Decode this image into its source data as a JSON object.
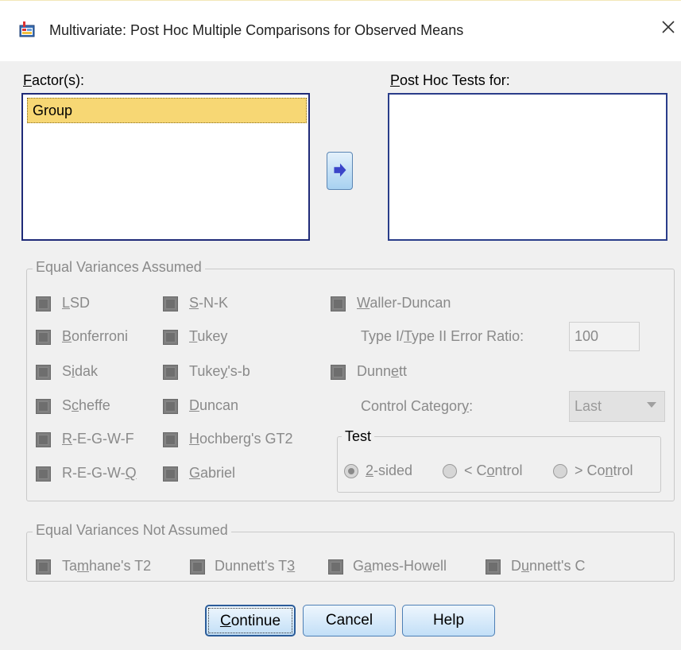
{
  "window": {
    "title": "Multivariate: Post Hoc Multiple Comparisons for Observed Means",
    "close_glyph": "✕",
    "icon": "spss-dialog-icon"
  },
  "factors": {
    "label_u": "F",
    "label_rest": "actor(s):",
    "items": [
      "Group"
    ]
  },
  "move_button": {
    "icon": "arrow-right-icon"
  },
  "post_hoc": {
    "label_u": "P",
    "label_rest": "ost Hoc Tests for:",
    "items": []
  },
  "equal_assumed": {
    "title": "Equal Variances Assumed",
    "lsd": {
      "u": "L",
      "rest": "SD"
    },
    "snk": {
      "u": "S",
      "rest": "-N-K"
    },
    "waller": {
      "u": "W",
      "rest": "aller-Duncan"
    },
    "bonferroni": {
      "u": "B",
      "rest": "onferroni"
    },
    "tukey": {
      "u": "T",
      "rest": "ukey"
    },
    "ratio_label_a": "Type I/",
    "ratio_label_u": "T",
    "ratio_label_b": "ype II Error Ratio:",
    "ratio_value": "100",
    "sidak_a": "S",
    "sidak_u": "i",
    "sidak_b": "dak",
    "tukeyb_a": "Tuke",
    "tukeyb_u": "y",
    "tukeyb_b": "'s-b",
    "dunnett_a": "Dunn",
    "dunnett_u": "e",
    "dunnett_b": "tt",
    "scheffe_a": "S",
    "scheffe_u": "c",
    "scheffe_b": "heffe",
    "duncan": {
      "u": "D",
      "rest": "uncan"
    },
    "control_label_a": "Control Categor",
    "control_label_u": "y",
    "control_label_b": ":",
    "control_value": "Last",
    "regwf": {
      "u": "R",
      "rest": "-E-G-W-F"
    },
    "hochberg": {
      "u": "H",
      "rest": "ochberg's GT2"
    },
    "regwq_a": "R-E-G-W-",
    "regwq_u": "Q",
    "gabriel": {
      "u": "G",
      "rest": "abriel"
    },
    "test": {
      "title": "Test",
      "two_sided": {
        "u": "2",
        "rest": "-sided"
      },
      "lt_control_a": "< C",
      "lt_control_u": "o",
      "lt_control_b": "ntrol",
      "gt_control_a": "> Co",
      "gt_control_u": "n",
      "gt_control_b": "trol",
      "selected": "2-sided"
    }
  },
  "not_assumed": {
    "title": "Equal Variances Not Assumed",
    "tamhane_a": "Ta",
    "tamhane_u": "m",
    "tamhane_b": "hane's T2",
    "dunnett_t3_a": "Dunnett's T",
    "dunnett_t3_u": "3",
    "games_a": "G",
    "games_u": "a",
    "games_b": "mes-Howell",
    "dunnett_c_a": "D",
    "dunnett_c_u": "u",
    "dunnett_c_b": "nnett's C"
  },
  "buttons": {
    "continue_u": "C",
    "continue_rest": "ontinue",
    "cancel": "Cancel",
    "help": "Help"
  }
}
